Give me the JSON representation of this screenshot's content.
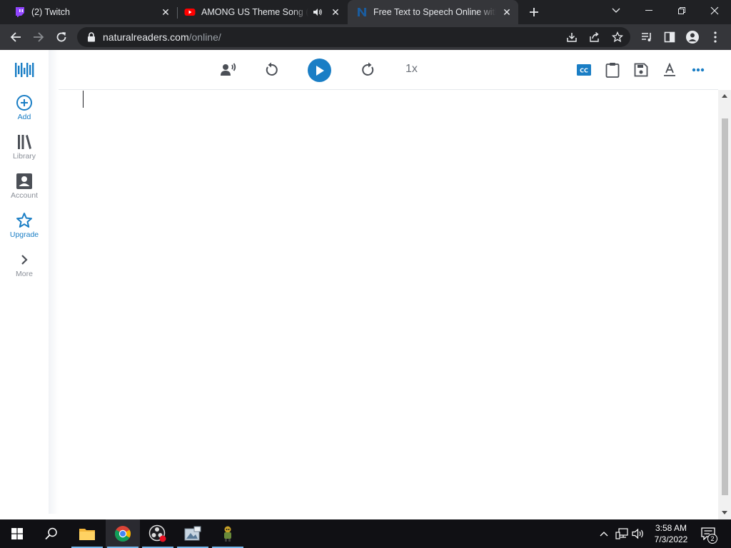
{
  "browser": {
    "tabs": [
      {
        "title": "(2) Twitch",
        "icon": "twitch-icon",
        "active": false
      },
      {
        "title": "AMONG US Theme Song (M",
        "icon": "youtube-icon",
        "active": false,
        "audio": true
      },
      {
        "title": "Free Text to Speech Online with A",
        "icon": "naturalreaders-icon",
        "active": true
      }
    ],
    "address": {
      "host": "naturalreaders.com",
      "path": "/online/"
    }
  },
  "sidebar": {
    "items": [
      {
        "label": "Add",
        "icon": "add-circle-icon"
      },
      {
        "label": "Library",
        "icon": "library-icon"
      },
      {
        "label": "Account",
        "icon": "account-icon"
      },
      {
        "label": "Upgrade",
        "icon": "star-icon"
      },
      {
        "label": "More",
        "icon": "chevron-right-icon"
      }
    ]
  },
  "player": {
    "speed": "1x"
  },
  "taskbar": {
    "time": "3:58 AM",
    "date": "7/3/2022",
    "notification_count": "2"
  },
  "colors": {
    "accent": "#1a7ec5",
    "chrome_dark": "#202124",
    "chrome_toolbar": "#35363a"
  }
}
